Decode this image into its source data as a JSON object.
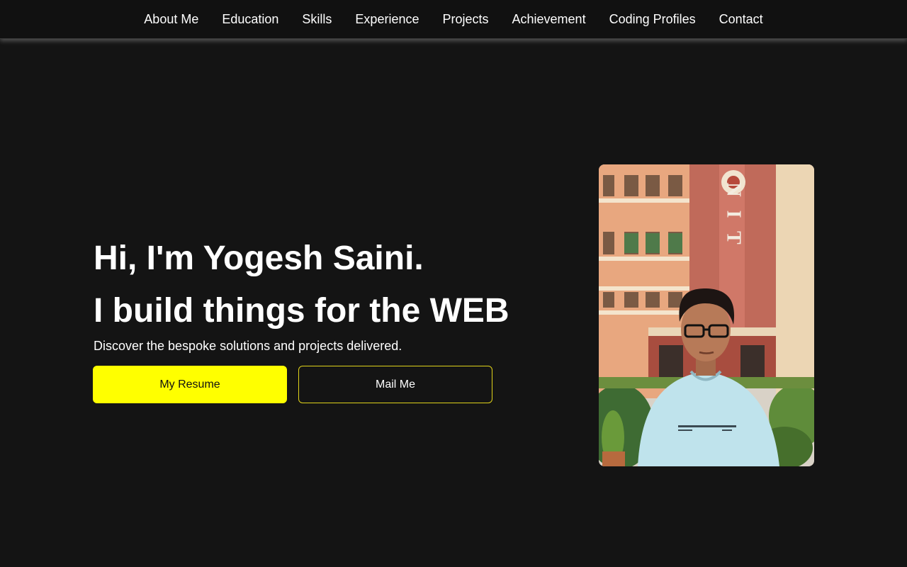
{
  "nav": {
    "items": [
      {
        "label": "About Me"
      },
      {
        "label": "Education"
      },
      {
        "label": "Skills"
      },
      {
        "label": "Experience"
      },
      {
        "label": "Projects"
      },
      {
        "label": "Achievement"
      },
      {
        "label": "Coding Profiles"
      },
      {
        "label": "Contact"
      }
    ]
  },
  "hero": {
    "greeting": "Hi, I'm Yogesh Saini.",
    "tagline": "I build things for the WEB",
    "description": "Discover the bespoke solutions and projects delivered.",
    "resume_label": "My Resume",
    "mail_label": "Mail Me",
    "photo_sign": "N I T"
  },
  "colors": {
    "background": "#141414",
    "accent": "#ffff00",
    "text": "#ffffff"
  }
}
